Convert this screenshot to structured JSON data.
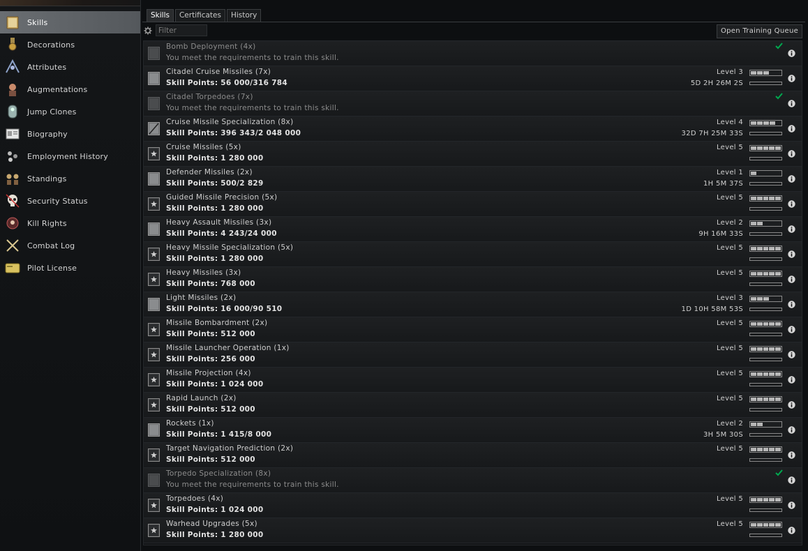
{
  "sidebar": {
    "items": [
      {
        "label": "Skills",
        "icon": "skills-book-icon",
        "active": true
      },
      {
        "label": "Decorations",
        "icon": "medal-icon",
        "active": false
      },
      {
        "label": "Attributes",
        "icon": "attributes-icon",
        "active": false
      },
      {
        "label": "Augmentations",
        "icon": "augmentations-icon",
        "active": false
      },
      {
        "label": "Jump Clones",
        "icon": "jump-clone-icon",
        "active": false
      },
      {
        "label": "Biography",
        "icon": "biography-icon",
        "active": false
      },
      {
        "label": "Employment History",
        "icon": "employment-icon",
        "active": false
      },
      {
        "label": "Standings",
        "icon": "standings-icon",
        "active": false
      },
      {
        "label": "Security Status",
        "icon": "skull-icon",
        "active": false
      },
      {
        "label": "Kill Rights",
        "icon": "kill-rights-icon",
        "active": false
      },
      {
        "label": "Combat Log",
        "icon": "crossed-swords-icon",
        "active": false
      },
      {
        "label": "Pilot License",
        "icon": "license-card-icon",
        "active": false
      }
    ]
  },
  "tabs": [
    {
      "label": "Skills",
      "active": true
    },
    {
      "label": "Certificates",
      "active": false
    },
    {
      "label": "History",
      "active": false
    }
  ],
  "filter": {
    "placeholder": "Filter"
  },
  "queue_button": "Open Training Queue",
  "colors": {
    "accent": "#00a84f",
    "level_fill": "#b8b8b8"
  },
  "skills": [
    {
      "name": "Bomb Deployment (4x)",
      "sub": "You meet the requirements to train this skill.",
      "state": "can_train",
      "level": null,
      "level_num": 0,
      "progress": 0,
      "time": ""
    },
    {
      "name": "Citadel Cruise Missiles (7x)",
      "sub": "Skill Points: 56 000/316 784",
      "state": "partial",
      "level": "Level 3",
      "level_num": 3,
      "progress": 0,
      "time": "5D 2H 26M 2S"
    },
    {
      "name": "Citadel Torpedoes (7x)",
      "sub": "You meet the requirements to train this skill.",
      "state": "can_train",
      "level": null,
      "level_num": 0,
      "progress": 0,
      "time": ""
    },
    {
      "name": "Cruise Missile Specialization (8x)",
      "sub": "Skill Points: 396 343/2 048 000",
      "state": "partial",
      "level": "Level 4",
      "level_num": 4,
      "progress": 0,
      "time": "32D 7H 25M 33S"
    },
    {
      "name": "Cruise Missiles (5x)",
      "sub": "Skill Points: 1 280 000",
      "state": "maxed",
      "level": "Level 5",
      "level_num": 5,
      "progress": 0,
      "time": ""
    },
    {
      "name": "Defender Missiles (2x)",
      "sub": "Skill Points: 500/2 829",
      "state": "partial",
      "level": "Level 1",
      "level_num": 1,
      "progress": 0,
      "time": "1H 5M 37S"
    },
    {
      "name": "Guided Missile Precision (5x)",
      "sub": "Skill Points: 1 280 000",
      "state": "maxed",
      "level": "Level 5",
      "level_num": 5,
      "progress": 0,
      "time": ""
    },
    {
      "name": "Heavy Assault Missiles (3x)",
      "sub": "Skill Points: 4 243/24 000",
      "state": "partial",
      "level": "Level 2",
      "level_num": 2,
      "progress": 0,
      "time": "9H 16M 33S"
    },
    {
      "name": "Heavy Missile Specialization (5x)",
      "sub": "Skill Points: 1 280 000",
      "state": "maxed",
      "level": "Level 5",
      "level_num": 5,
      "progress": 0,
      "time": ""
    },
    {
      "name": "Heavy Missiles (3x)",
      "sub": "Skill Points: 768 000",
      "state": "maxed",
      "level": "Level 5",
      "level_num": 5,
      "progress": 0,
      "time": ""
    },
    {
      "name": "Light Missiles (2x)",
      "sub": "Skill Points: 16 000/90 510",
      "state": "partial",
      "level": "Level 3",
      "level_num": 3,
      "progress": 0,
      "time": "1D 10H 58M 53S"
    },
    {
      "name": "Missile Bombardment (2x)",
      "sub": "Skill Points: 512 000",
      "state": "maxed",
      "level": "Level 5",
      "level_num": 5,
      "progress": 0,
      "time": ""
    },
    {
      "name": "Missile Launcher Operation (1x)",
      "sub": "Skill Points: 256 000",
      "state": "maxed",
      "level": "Level 5",
      "level_num": 5,
      "progress": 0,
      "time": ""
    },
    {
      "name": "Missile Projection (4x)",
      "sub": "Skill Points: 1 024 000",
      "state": "maxed",
      "level": "Level 5",
      "level_num": 5,
      "progress": 0,
      "time": ""
    },
    {
      "name": "Rapid Launch (2x)",
      "sub": "Skill Points: 512 000",
      "state": "maxed",
      "level": "Level 5",
      "level_num": 5,
      "progress": 0,
      "time": ""
    },
    {
      "name": "Rockets (1x)",
      "sub": "Skill Points: 1 415/8 000",
      "state": "partial",
      "level": "Level 2",
      "level_num": 2,
      "progress": 0,
      "time": "3H 5M 30S"
    },
    {
      "name": "Target Navigation Prediction (2x)",
      "sub": "Skill Points: 512 000",
      "state": "maxed",
      "level": "Level 5",
      "level_num": 5,
      "progress": 0,
      "time": ""
    },
    {
      "name": "Torpedo Specialization (8x)",
      "sub": "You meet the requirements to train this skill.",
      "state": "can_train",
      "level": null,
      "level_num": 0,
      "progress": 0,
      "time": ""
    },
    {
      "name": "Torpedoes (4x)",
      "sub": "Skill Points: 1 024 000",
      "state": "maxed",
      "level": "Level 5",
      "level_num": 5,
      "progress": 0,
      "time": ""
    },
    {
      "name": "Warhead Upgrades (5x)",
      "sub": "Skill Points: 1 280 000",
      "state": "maxed",
      "level": "Level 5",
      "level_num": 5,
      "progress": 0,
      "time": ""
    }
  ]
}
